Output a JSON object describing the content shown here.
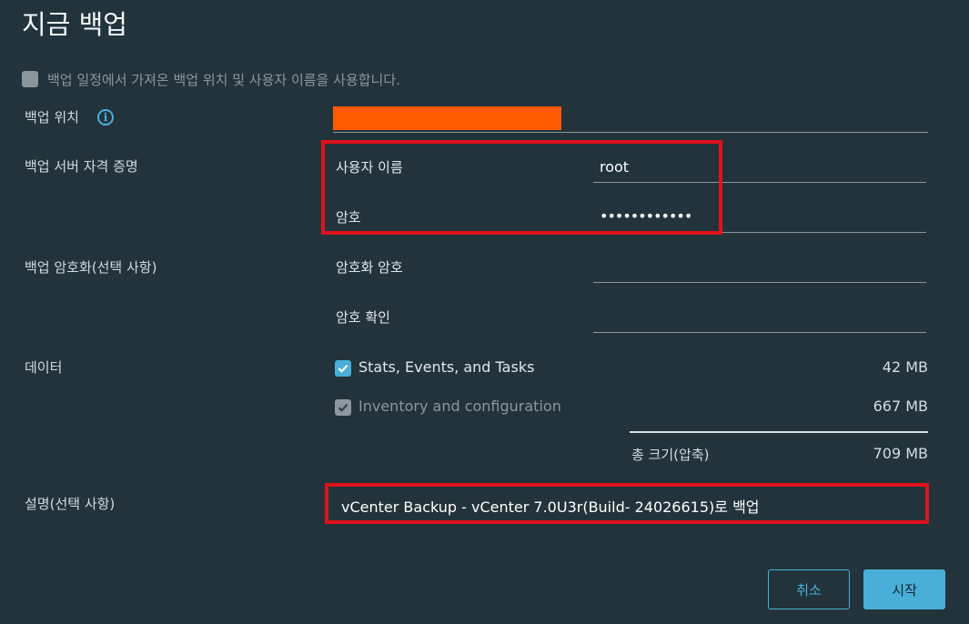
{
  "header": {
    "title": "지금 백업"
  },
  "use_schedule": {
    "label": "백업 일정에서 가져온 백업 위치 및 사용자 이름을 사용합니다.",
    "checked": false
  },
  "location": {
    "label": "백업 위치",
    "value_redacted": true,
    "info_icon": "info-icon"
  },
  "credentials": {
    "label": "백업 서버 자격 증명",
    "username_label": "사용자 이름",
    "username_value": "root",
    "password_label": "암호",
    "password_value": "••••••••••••"
  },
  "encryption": {
    "label": "백업 암호화(선택 사항)",
    "password_label": "암호화 암호",
    "confirm_label": "암호 확인"
  },
  "data": {
    "label": "데이터",
    "items": [
      {
        "label": "Stats, Events, and Tasks",
        "size": "42 MB",
        "checked": true,
        "disabled": false
      },
      {
        "label": "Inventory and configuration",
        "size": "667 MB",
        "checked": true,
        "disabled": true
      }
    ],
    "total_label": "총 크기(압축)",
    "total_size": "709 MB"
  },
  "description": {
    "label": "설명(선택 사항)",
    "value": "vCenter Backup - vCenter 7.0U3r(Build- 24026615)로 백업"
  },
  "buttons": {
    "cancel": "취소",
    "start": "시작"
  },
  "colors": {
    "background": "#22333b",
    "accent": "#49afd9",
    "highlight": "#e0121a",
    "redaction": "#ff5a00"
  }
}
